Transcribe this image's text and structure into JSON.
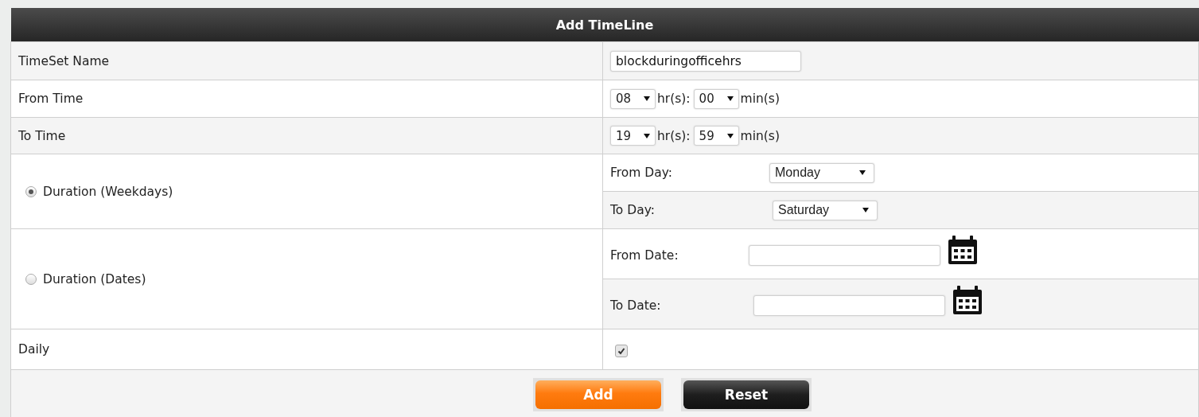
{
  "title": "Add TimeLine",
  "timeset_name": {
    "label": "TimeSet Name",
    "value": "blockduringofficehrs"
  },
  "from_time": {
    "label": "From Time",
    "hour": "08",
    "hr_unit": "hr(s):",
    "minute": "00",
    "min_unit": "min(s)"
  },
  "to_time": {
    "label": "To Time",
    "hour": "19",
    "hr_unit": "hr(s):",
    "minute": "59",
    "min_unit": "min(s)"
  },
  "duration_weekdays": {
    "label": "Duration (Weekdays)",
    "selected": true,
    "from_day": {
      "label": "From Day:",
      "value": "Monday"
    },
    "to_day": {
      "label": "To Day:",
      "value": "Saturday"
    }
  },
  "duration_dates": {
    "label": "Duration (Dates)",
    "selected": false,
    "from_date": {
      "label": "From Date:"
    },
    "to_date": {
      "label": "To Date:"
    }
  },
  "daily": {
    "label": "Daily",
    "checked": true
  },
  "buttons": [
    {
      "label": "Add",
      "kind": "primary"
    },
    {
      "label": "Reset",
      "kind": "secondary"
    }
  ]
}
